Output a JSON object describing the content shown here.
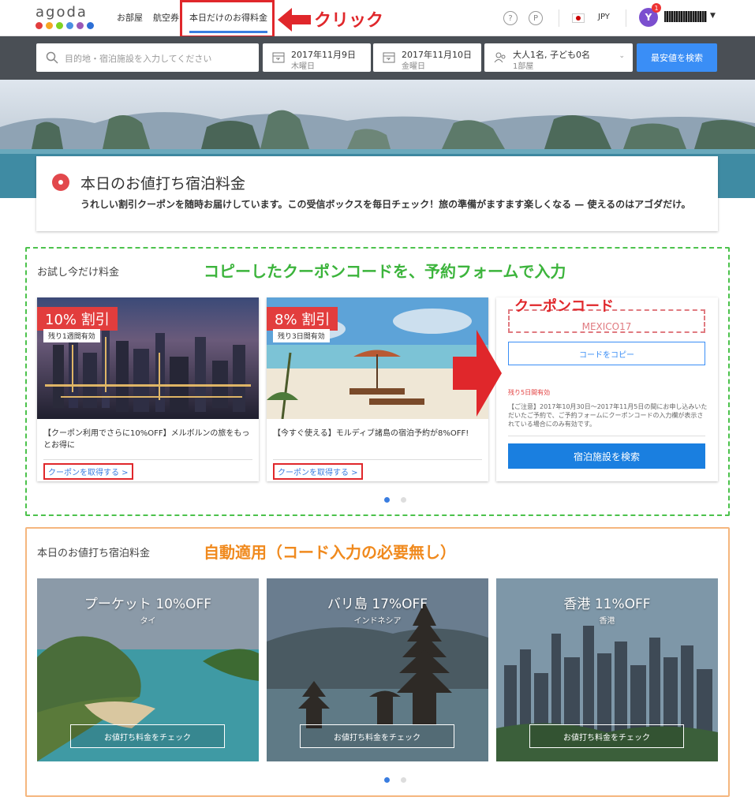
{
  "nav": {
    "logo_text": "agoda",
    "logo_colors": [
      "#e23d3d",
      "#f5a623",
      "#7ed321",
      "#4a90e2",
      "#9b59b6",
      "#2d6fd6"
    ],
    "items": [
      "お部屋",
      "航空券",
      "本日だけのお得料金"
    ],
    "currency": "JPY",
    "avatar_initial": "Y",
    "notification_count": "1"
  },
  "annotations": {
    "click": "クリック",
    "section1": "コピーしたクーポンコードを、予約フォームで入力",
    "coupon_code_label": "クーポンコード",
    "section2": "自動適用（コード入力の必要無し）"
  },
  "search": {
    "placeholder": "目的地・宿泊施設を入力してください",
    "checkin_date": "2017年11月9日",
    "checkin_day": "木曜日",
    "checkout_date": "2017年11月10日",
    "checkout_day": "金曜日",
    "guests": "大人1名, 子ども0名",
    "rooms": "1部屋",
    "button": "最安値を検索"
  },
  "deals_header": {
    "title": "本日のお値打ち宿泊料金",
    "description": "うれしい割引クーポンを随時お届けしています。この受信ボックスを毎日チェック！旅の準備がますます楽しくなる — 使えるのはアゴダだけ。"
  },
  "coupon_section": {
    "label": "お試し今だけ料金",
    "coupons": [
      {
        "discount": "10% 割引",
        "remaining": "残り1週間有効",
        "description": "【クーポン利用でさらに10%OFF】メルボルンの旅をもっとお得に",
        "link": "クーポンを取得する >"
      },
      {
        "discount": "8% 割引",
        "remaining": "残り3日間有効",
        "description": "【今すぐ使える】モルディブ諸島の宿泊予約が8%OFF!",
        "link": "クーポンを取得する >"
      }
    ],
    "code_card": {
      "code": "MEXICO17",
      "copy_button": "コードをコピー",
      "remaining": "残り5日間有効",
      "note": "【ご注意】2017年10月30日～2017年11月5日の間にお申し込みいただいたご予約で、ご予約フォームにクーポンコードの入力欄が表示されている場合にのみ有効です。",
      "search_button": "宿泊施設を検索"
    }
  },
  "deals_section": {
    "label": "本日のお値打ち宿泊料金",
    "destinations": [
      {
        "name": "プーケット 10%OFF",
        "country": "タイ",
        "button": "お値打ち料金をチェック"
      },
      {
        "name": "バリ島 17%OFF",
        "country": "インドネシア",
        "button": "お値打ち料金をチェック"
      },
      {
        "name": "香港 11%OFF",
        "country": "香港",
        "button": "お値打ち料金をチェック"
      }
    ]
  }
}
